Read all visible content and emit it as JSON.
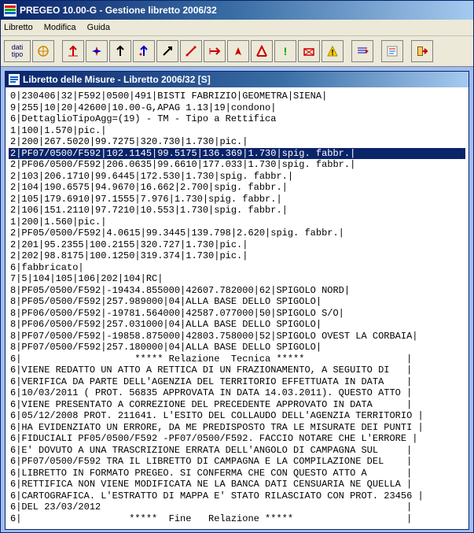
{
  "app_title": "PREGEO 10.00-G - Gestione libretto 2006/32",
  "menus": [
    "Libretto",
    "Modifica",
    "Guida"
  ],
  "dati_tipo_label": "dati\ntipo",
  "inner_title": "Libretto delle Misure - Libretto 2006/32 [S]",
  "selected_index": 5,
  "lines": [
    "0|230406|32|F592|0500|491|BISTI FABRIZIO|GEOMETRA|SIENA|",
    "9|255|10|20|42600|10.00-G,APAG 1.13|19|condono|",
    "6|DettaglioTipoAgg=(19) - TM - Tipo a Rettifica",
    "1|100|1.570|pic.|",
    "2|200|267.5020|99.7275|320.730|1.730|pic.|",
    "2|PF07/0500/F592|102.1145|99.5175|136.369|1.730|spig. fabbr.|",
    "2|PF06/0500/F592|206.0635|99.6610|177.033|1.730|spig. fabbr.|",
    "2|103|206.1710|99.6445|172.530|1.730|spig. fabbr.|",
    "2|104|190.6575|94.9670|16.662|2.700|spig. fabbr.|",
    "2|105|179.6910|97.1555|7.976|1.730|spig. fabbr.|",
    "2|106|151.2110|97.7210|10.553|1.730|spig. fabbr.|",
    "1|200|1.560|pic.|",
    "2|PF05/0500/F592|4.0615|99.3445|139.798|2.620|spig. fabbr.|",
    "2|201|95.2355|100.2155|320.727|1.730|pic.|",
    "2|202|98.8175|100.1250|319.374|1.730|pic.|",
    "6|fabbricato|",
    "7|5|104|105|106|202|104|RC|",
    "8|PF05/0500/F592|-19434.855000|42607.782000|62|SPIGOLO NORD|",
    "8|PF05/0500/F592|257.989000|04|ALLA BASE DELLO SPIGOLO|",
    "8|PF06/0500/F592|-19781.564000|42587.077000|50|SPIGOLO S/O|",
    "8|PF06/0500/F592|257.031000|04|ALLA BASE DELLO SPIGOLO|",
    "8|PF07/0500/F592|-19858.875000|42803.758000|52|SPIGOLO OVEST LA CORBAIA|",
    "8|PF07/0500/F592|257.180000|04|ALLA BASE DELLO SPIGOLO|",
    "6|                    ***** Relazione  Tecnica *****                  |",
    "6|VIENE REDATTO UN ATTO A RETTICA DI UN FRAZIONAMENTO, A SEGUITO DI   |",
    "6|VERIFICA DA PARTE DELL'AGENZIA DEL TERRITORIO EFFETTUATA IN DATA    |",
    "6|10/03/2011 ( PROT. 56835 APPROVATA IN DATA 14.03.2011). QUESTO ATTO |",
    "6|VIENE PRESENTATO A CORREZIONE DEL PRECEDENTE APPROVATO IN DATA      |",
    "6|05/12/2008 PROT. 211641. L'ESITO DEL COLLAUDO DELL'AGENZIA TERRITORIO |",
    "6|HA EVIDENZIATO UN ERRORE, DA ME PREDISPOSTO TRA LE MISURATE DEI PUNTI |",
    "6|FIDUCIALI PF05/0500/F592 -PF07/0500/F592. FACCIO NOTARE CHE L'ERRORE |",
    "6|E' DOVUTO A UNA TRASCRIZIONE ERRATA DELL'ANGOLO DI CAMPAGNA SUL     |",
    "6|PF07/0500/F592 TRA IL LIBRETTO DI CAMPAGNA E LA COMPILAZIONE DEL    |",
    "6|LIBRETTO IN FORMATO PREGEO. SI CONFERMA CHE CON QUESTO ATTO A       |",
    "6|RETTIFICA NON VIENE MODIFICATA NE LA BANCA DATI CENSUARIA NE QUELLA |",
    "6|CARTOGRAFICA. L'ESTRATTO DI MAPPA E' STATO RILASCIATO CON PROT. 23456 |",
    "6|DEL 23/03/2012                                                      |",
    "6|                   *****  Fine   Relazione *****                    |"
  ],
  "toolbar_icons": [
    "dati-tipo",
    "compass",
    "red-arrow-up",
    "red-arrow-down",
    "black-arrow",
    "blue-arrow",
    "black-arrow-2",
    "slash",
    "red-arrow-h",
    "compass-red",
    "red-arrow",
    "red-box",
    "green-excl",
    "survey",
    "yellow-tri",
    "lines",
    "text",
    "exit"
  ]
}
